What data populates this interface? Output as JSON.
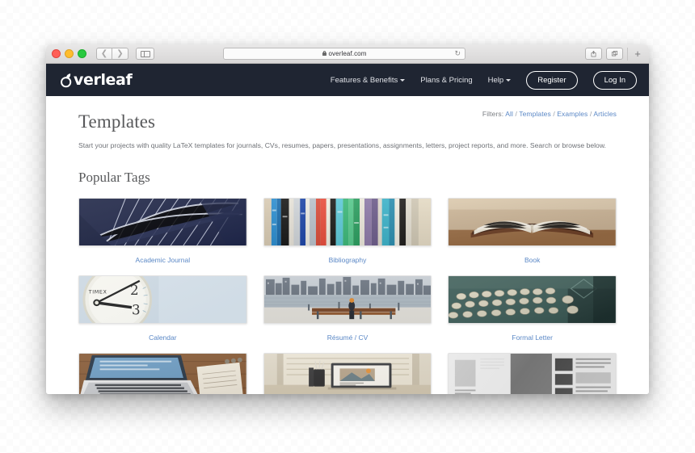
{
  "browser": {
    "url": "overleaf.com",
    "lock_icon": "lock-icon",
    "reload_icon": "reload-icon",
    "back_icon": "chevron-left-icon",
    "forward_icon": "chevron-right-icon",
    "sidebar_icon": "sidebar-toggle-icon",
    "share_icon": "share-icon",
    "tabs_icon": "tabs-overview-icon",
    "new_tab_label": "+"
  },
  "nav": {
    "brand": "verleaf",
    "brand_full": "Overleaf",
    "items": [
      {
        "label": "Features & Benefits",
        "has_caret": true
      },
      {
        "label": "Plans & Pricing",
        "has_caret": false
      },
      {
        "label": "Help",
        "has_caret": true
      }
    ],
    "register_label": "Register",
    "login_label": "Log In",
    "background": "#1f2532"
  },
  "filters": {
    "prefix": "Filters:",
    "items": [
      "All",
      "Templates",
      "Examples",
      "Articles"
    ],
    "separator": "/",
    "link_color": "#5b88c6"
  },
  "main": {
    "title": "Templates",
    "description": "Start your projects with quality LaTeX templates for journals, CVs, resumes, papers, presentations, assignments, letters, project reports, and more. Search or browse below.",
    "section_title": "Popular Tags"
  },
  "tags": [
    {
      "label": "Academic Journal",
      "image": "architecture-steel-structure"
    },
    {
      "label": "Bibliography",
      "image": "colorful-book-spines"
    },
    {
      "label": "Book",
      "image": "open-book-on-table"
    },
    {
      "label": "Calendar",
      "image": "timex-wall-clock"
    },
    {
      "label": "Résumé / CV",
      "image": "city-skyline-bench"
    },
    {
      "label": "Formal Letter",
      "image": "vintage-typewriter"
    },
    {
      "label": "",
      "image": "laptop-and-notebook-desk"
    },
    {
      "label": "",
      "image": "tablet-on-desk-by-window"
    },
    {
      "label": "",
      "image": "newspaper-pages"
    }
  ]
}
